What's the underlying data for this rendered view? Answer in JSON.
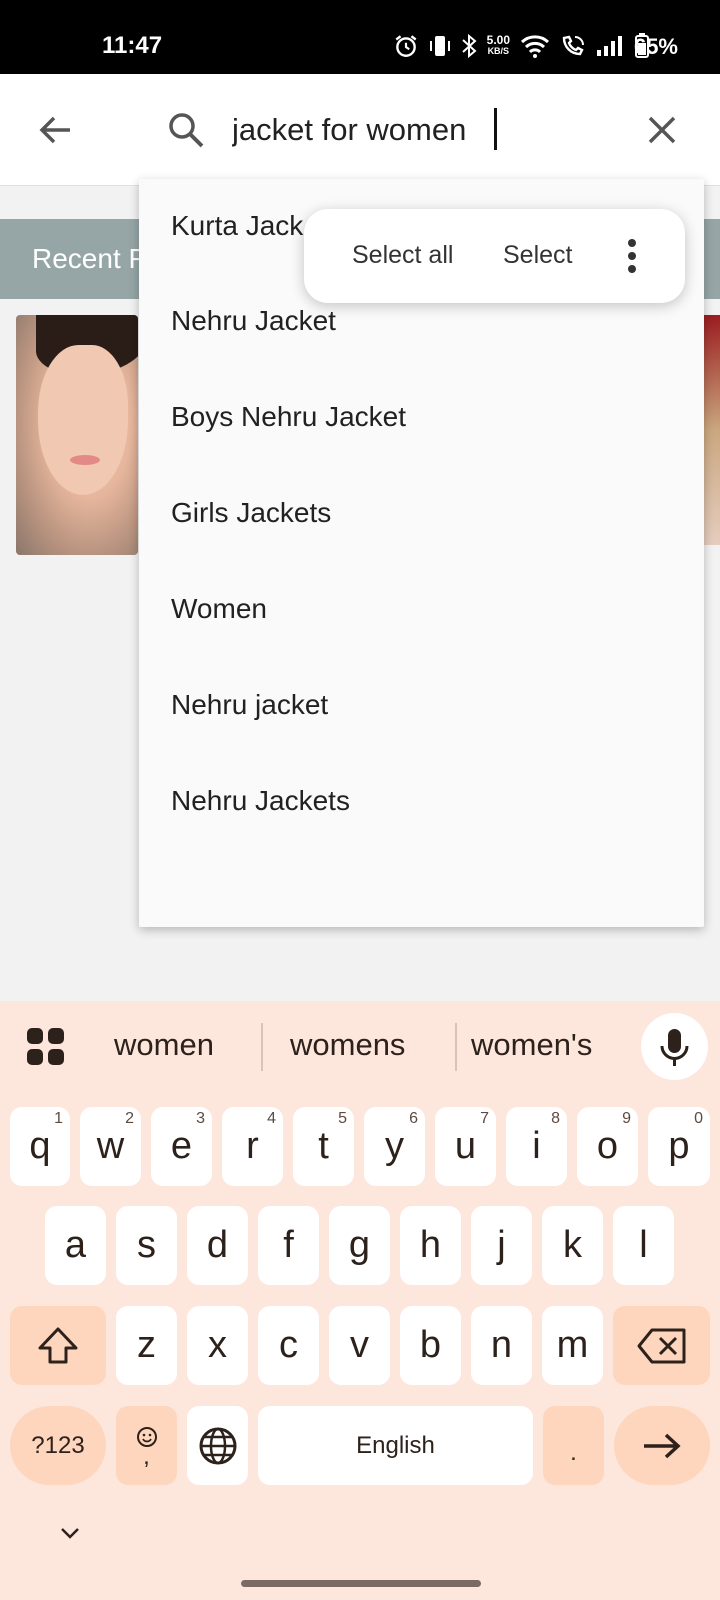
{
  "status_bar": {
    "time": "11:47",
    "net_speed_value": "5.00",
    "net_speed_unit": "KB/S",
    "battery": "65%"
  },
  "search": {
    "query": "jacket for women"
  },
  "background": {
    "section_title": "Recent F"
  },
  "suggestions": [
    "Kurta Jack",
    "Nehru Jacket",
    "Boys Nehru Jacket",
    "Girls Jackets",
    "Women",
    "Nehru jacket",
    "Nehru Jackets"
  ],
  "selection_popup": {
    "select_all": "Select all",
    "select": "Select"
  },
  "keyboard": {
    "word_suggestions": [
      "women",
      "womens",
      "women's"
    ],
    "row1": [
      {
        "key": "q",
        "hint": "1"
      },
      {
        "key": "w",
        "hint": "2"
      },
      {
        "key": "e",
        "hint": "3"
      },
      {
        "key": "r",
        "hint": "4"
      },
      {
        "key": "t",
        "hint": "5"
      },
      {
        "key": "y",
        "hint": "6"
      },
      {
        "key": "u",
        "hint": "7"
      },
      {
        "key": "i",
        "hint": "8"
      },
      {
        "key": "o",
        "hint": "9"
      },
      {
        "key": "p",
        "hint": "0"
      }
    ],
    "row2": [
      "a",
      "s",
      "d",
      "f",
      "g",
      "h",
      "j",
      "k",
      "l"
    ],
    "row3": [
      "z",
      "x",
      "c",
      "v",
      "b",
      "n",
      "m"
    ],
    "symbols_label": "?123",
    "emoji_comma": ",",
    "space_label": "English",
    "period": ".",
    "colors": {
      "background": "#fde7dc",
      "key": "#ffffff",
      "function_key": "#fdd6bd"
    }
  }
}
